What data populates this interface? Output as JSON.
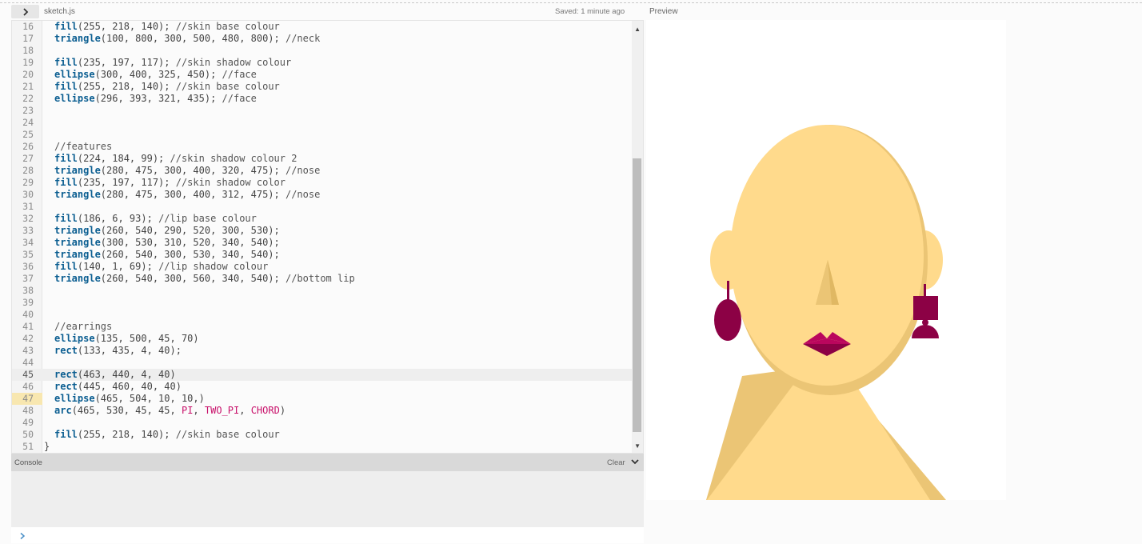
{
  "header": {
    "file_name": "sketch.js",
    "saved_status": "Saved: 1 minute ago",
    "preview_label": "Preview"
  },
  "editor": {
    "lines": [
      {
        "n": "16",
        "tokens": [
          {
            "t": "fn",
            "v": "fill"
          },
          {
            "t": "p",
            "v": "(255, 218, 140); "
          },
          {
            "t": "cmt",
            "v": "//skin base colour"
          }
        ]
      },
      {
        "n": "17",
        "tokens": [
          {
            "t": "fn",
            "v": "triangle"
          },
          {
            "t": "p",
            "v": "(100, 800, 300, 500, 480, 800); "
          },
          {
            "t": "cmt",
            "v": "//neck"
          }
        ]
      },
      {
        "n": "18",
        "tokens": []
      },
      {
        "n": "19",
        "tokens": [
          {
            "t": "fn",
            "v": "fill"
          },
          {
            "t": "p",
            "v": "(235, 197, 117); "
          },
          {
            "t": "cmt",
            "v": "//skin shadow colour"
          }
        ]
      },
      {
        "n": "20",
        "tokens": [
          {
            "t": "fn",
            "v": "ellipse"
          },
          {
            "t": "p",
            "v": "(300, 400, 325, 450); "
          },
          {
            "t": "cmt",
            "v": "//face"
          }
        ]
      },
      {
        "n": "21",
        "tokens": [
          {
            "t": "fn",
            "v": "fill"
          },
          {
            "t": "p",
            "v": "(255, 218, 140); "
          },
          {
            "t": "cmt",
            "v": "//skin base colour"
          }
        ]
      },
      {
        "n": "22",
        "tokens": [
          {
            "t": "fn",
            "v": "ellipse"
          },
          {
            "t": "p",
            "v": "(296, 393, 321, 435); "
          },
          {
            "t": "cmt",
            "v": "//face"
          }
        ]
      },
      {
        "n": "23",
        "tokens": []
      },
      {
        "n": "24",
        "tokens": []
      },
      {
        "n": "25",
        "tokens": []
      },
      {
        "n": "26",
        "tokens": [
          {
            "t": "cmt",
            "v": "//features"
          }
        ]
      },
      {
        "n": "27",
        "tokens": [
          {
            "t": "fn",
            "v": "fill"
          },
          {
            "t": "p",
            "v": "(224, 184, 99); "
          },
          {
            "t": "cmt",
            "v": "//skin shadow colour 2"
          }
        ]
      },
      {
        "n": "28",
        "tokens": [
          {
            "t": "fn",
            "v": "triangle"
          },
          {
            "t": "p",
            "v": "(280, 475, 300, 400, 320, 475); "
          },
          {
            "t": "cmt",
            "v": "//nose"
          }
        ]
      },
      {
        "n": "29",
        "tokens": [
          {
            "t": "fn",
            "v": "fill"
          },
          {
            "t": "p",
            "v": "(235, 197, 117); "
          },
          {
            "t": "cmt",
            "v": "//skin shadow color"
          }
        ]
      },
      {
        "n": "30",
        "tokens": [
          {
            "t": "fn",
            "v": "triangle"
          },
          {
            "t": "p",
            "v": "(280, 475, 300, 400, 312, 475); "
          },
          {
            "t": "cmt",
            "v": "//nose"
          }
        ]
      },
      {
        "n": "31",
        "tokens": []
      },
      {
        "n": "32",
        "tokens": [
          {
            "t": "fn",
            "v": "fill"
          },
          {
            "t": "p",
            "v": "(186, 6, 93); "
          },
          {
            "t": "cmt",
            "v": "//lip base colour"
          }
        ]
      },
      {
        "n": "33",
        "tokens": [
          {
            "t": "fn",
            "v": "triangle"
          },
          {
            "t": "p",
            "v": "(260, 540, 290, 520, 300, 530);"
          }
        ]
      },
      {
        "n": "34",
        "tokens": [
          {
            "t": "fn",
            "v": "triangle"
          },
          {
            "t": "p",
            "v": "(300, 530, 310, 520, 340, 540);"
          }
        ]
      },
      {
        "n": "35",
        "tokens": [
          {
            "t": "fn",
            "v": "triangle"
          },
          {
            "t": "p",
            "v": "(260, 540, 300, 530, 340, 540);"
          }
        ]
      },
      {
        "n": "36",
        "tokens": [
          {
            "t": "fn",
            "v": "fill"
          },
          {
            "t": "p",
            "v": "(140, 1, 69); "
          },
          {
            "t": "cmt",
            "v": "//lip shadow colour"
          }
        ]
      },
      {
        "n": "37",
        "tokens": [
          {
            "t": "fn",
            "v": "triangle"
          },
          {
            "t": "p",
            "v": "(260, 540, 300, 560, 340, 540); "
          },
          {
            "t": "cmt",
            "v": "//bottom lip"
          }
        ]
      },
      {
        "n": "38",
        "tokens": []
      },
      {
        "n": "39",
        "tokens": []
      },
      {
        "n": "40",
        "tokens": []
      },
      {
        "n": "41",
        "tokens": [
          {
            "t": "cmt",
            "v": "//earrings"
          }
        ]
      },
      {
        "n": "42",
        "tokens": [
          {
            "t": "fn",
            "v": "ellipse"
          },
          {
            "t": "p",
            "v": "(135, 500, 45, 70)"
          }
        ]
      },
      {
        "n": "43",
        "tokens": [
          {
            "t": "fn",
            "v": "rect"
          },
          {
            "t": "p",
            "v": "(133, 435, 4, 40);"
          }
        ]
      },
      {
        "n": "44",
        "tokens": []
      },
      {
        "n": "45",
        "active": true,
        "tokens": [
          {
            "t": "fn",
            "v": "rect"
          },
          {
            "t": "p",
            "v": "(463, 440, 4, 40)"
          }
        ]
      },
      {
        "n": "46",
        "tokens": [
          {
            "t": "fn",
            "v": "rect"
          },
          {
            "t": "p",
            "v": "(445, 460, 40, 40)"
          }
        ]
      },
      {
        "n": "47",
        "warn": true,
        "tokens": [
          {
            "t": "fn",
            "v": "ellipse"
          },
          {
            "t": "p",
            "v": "(465, 504, 10, 10,)"
          }
        ]
      },
      {
        "n": "48",
        "tokens": [
          {
            "t": "fn",
            "v": "arc"
          },
          {
            "t": "p",
            "v": "(465, 530, 45, 45, "
          },
          {
            "t": "const",
            "v": "PI"
          },
          {
            "t": "p",
            "v": ", "
          },
          {
            "t": "const",
            "v": "TWO_PI"
          },
          {
            "t": "p",
            "v": ", "
          },
          {
            "t": "const",
            "v": "CHORD"
          },
          {
            "t": "p",
            "v": ")"
          }
        ]
      },
      {
        "n": "49",
        "tokens": []
      },
      {
        "n": "50",
        "tokens": [
          {
            "t": "fn",
            "v": "fill"
          },
          {
            "t": "p",
            "v": "(255, 218, 140); "
          },
          {
            "t": "cmt",
            "v": "//skin base colour"
          }
        ]
      },
      {
        "n": "51",
        "tokens": [
          {
            "t": "p",
            "v": "}"
          }
        ],
        "outdent": true
      }
    ]
  },
  "console": {
    "title": "Console",
    "clear_label": "Clear"
  },
  "colors": {
    "skin_base": "#ffda8c",
    "skin_shadow": "#ebc575",
    "skin_shadow_2": "#e0b863",
    "lip_base": "#ba065d",
    "lip_shadow": "#8c0145",
    "code_function": "#0b5e91",
    "code_constant": "#c8106a"
  },
  "icons": {
    "toggle": "chevron-right-icon",
    "console_collapse": "chevron-down-icon",
    "console_prompt": "chevron-right-icon"
  }
}
